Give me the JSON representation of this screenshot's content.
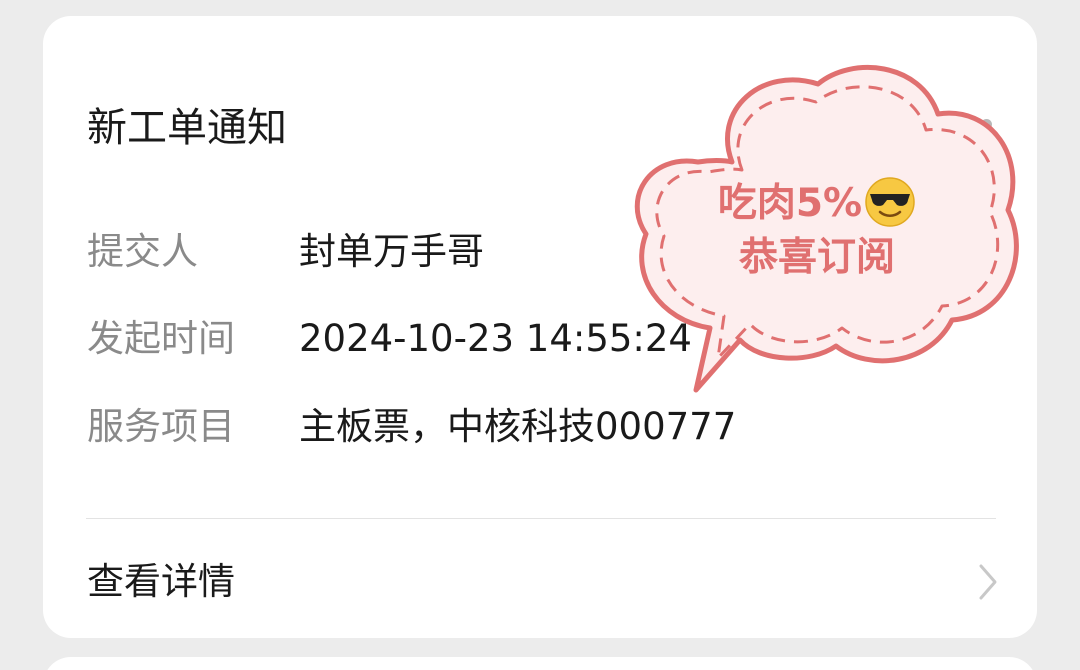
{
  "card": {
    "title": "新工单通知",
    "rows": [
      {
        "label": "提交人",
        "value": "封单万手哥"
      },
      {
        "label": "发起时间",
        "value": "2024-10-23 14:55:24"
      },
      {
        "label": "服务项目",
        "value": "主板票，中核科技000777"
      }
    ],
    "detail_label": "查看详情"
  },
  "sticker": {
    "line1": "吃肉5%",
    "line2": "恭喜订阅",
    "emoji_icon": "sunglasses-face-icon"
  },
  "colors": {
    "sticker_accent": "#e07070",
    "sticker_fill": "#fdeeee",
    "label_gray": "#8a8a8a",
    "text_dark": "#1a1a1a",
    "background": "#ececec"
  }
}
